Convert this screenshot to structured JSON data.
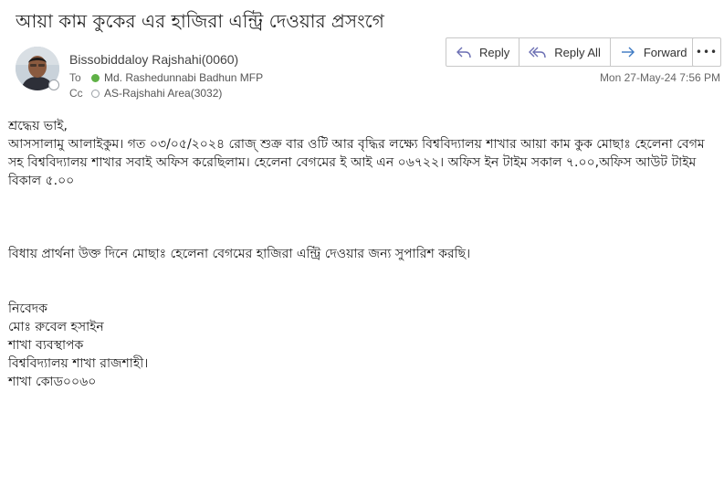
{
  "email": {
    "subject": "আয়া কাম কুকের এর  হাজিরা  এন্ট্রি দেওয়ার প্রসংগে",
    "sender": "Bissobiddaloy Rajshahi(0060)",
    "to_label": "To",
    "to_value": "Md. Rashedunnabi Badhun MFP",
    "cc_label": "Cc",
    "cc_value": "AS-Rajshahi Area(3032)",
    "timestamp": "Mon 27-May-24 7:56 PM"
  },
  "actions": {
    "reply_label": "Reply",
    "reply_all_label": "Reply All",
    "forward_label": "Forward",
    "more_label": "•••"
  },
  "icons": {
    "reply": "reply-icon",
    "reply_all": "reply-all-icon",
    "forward": "forward-icon",
    "more": "more-icon",
    "to_status": "available-status-icon",
    "cc_status": "offline-status-icon"
  },
  "colors": {
    "accent": "#6b6fb3",
    "status_available": "#5fb146"
  },
  "body": {
    "salutation": "শ্রদ্ধেয় ভাই,",
    "paragraph1": "আসসালামু আলাইকুম। গত ০৩/০৫/২০২৪ রোজ্ শুক্র বার  ওটি আর বৃদ্ধির লক্ষ্যে বিশ্ববিদ্যালয় শাখার আয়া কাম কুক মোছাঃ হেলেনা বেগম সহ বিশ্ববিদ্যালয় শাখার সবাই অফিস করেছিলাম।  হেলেনা বেগমের ই আই এন ০৬৭২২। অফিস ইন টাইম সকাল ৭.০০,অফিস আউট টাইম বিকাল ৫.০০",
    "paragraph2": "বিধায় প্রার্থনা উক্ত দিনে মোছাঃ হেলেনা বেগমের হাজিরা এন্ট্রি দেওয়ার জন্য সুপারিশ করছি।",
    "signature_lines": [
      "নিবেদক",
      "মোঃ রুবেল হসাইন",
      "শাখা ব্যবস্থাপক",
      "বিশ্ববিদ্যালয় শাখা রাজশাহী।",
      "শাখা কোড০০৬০"
    ]
  }
}
